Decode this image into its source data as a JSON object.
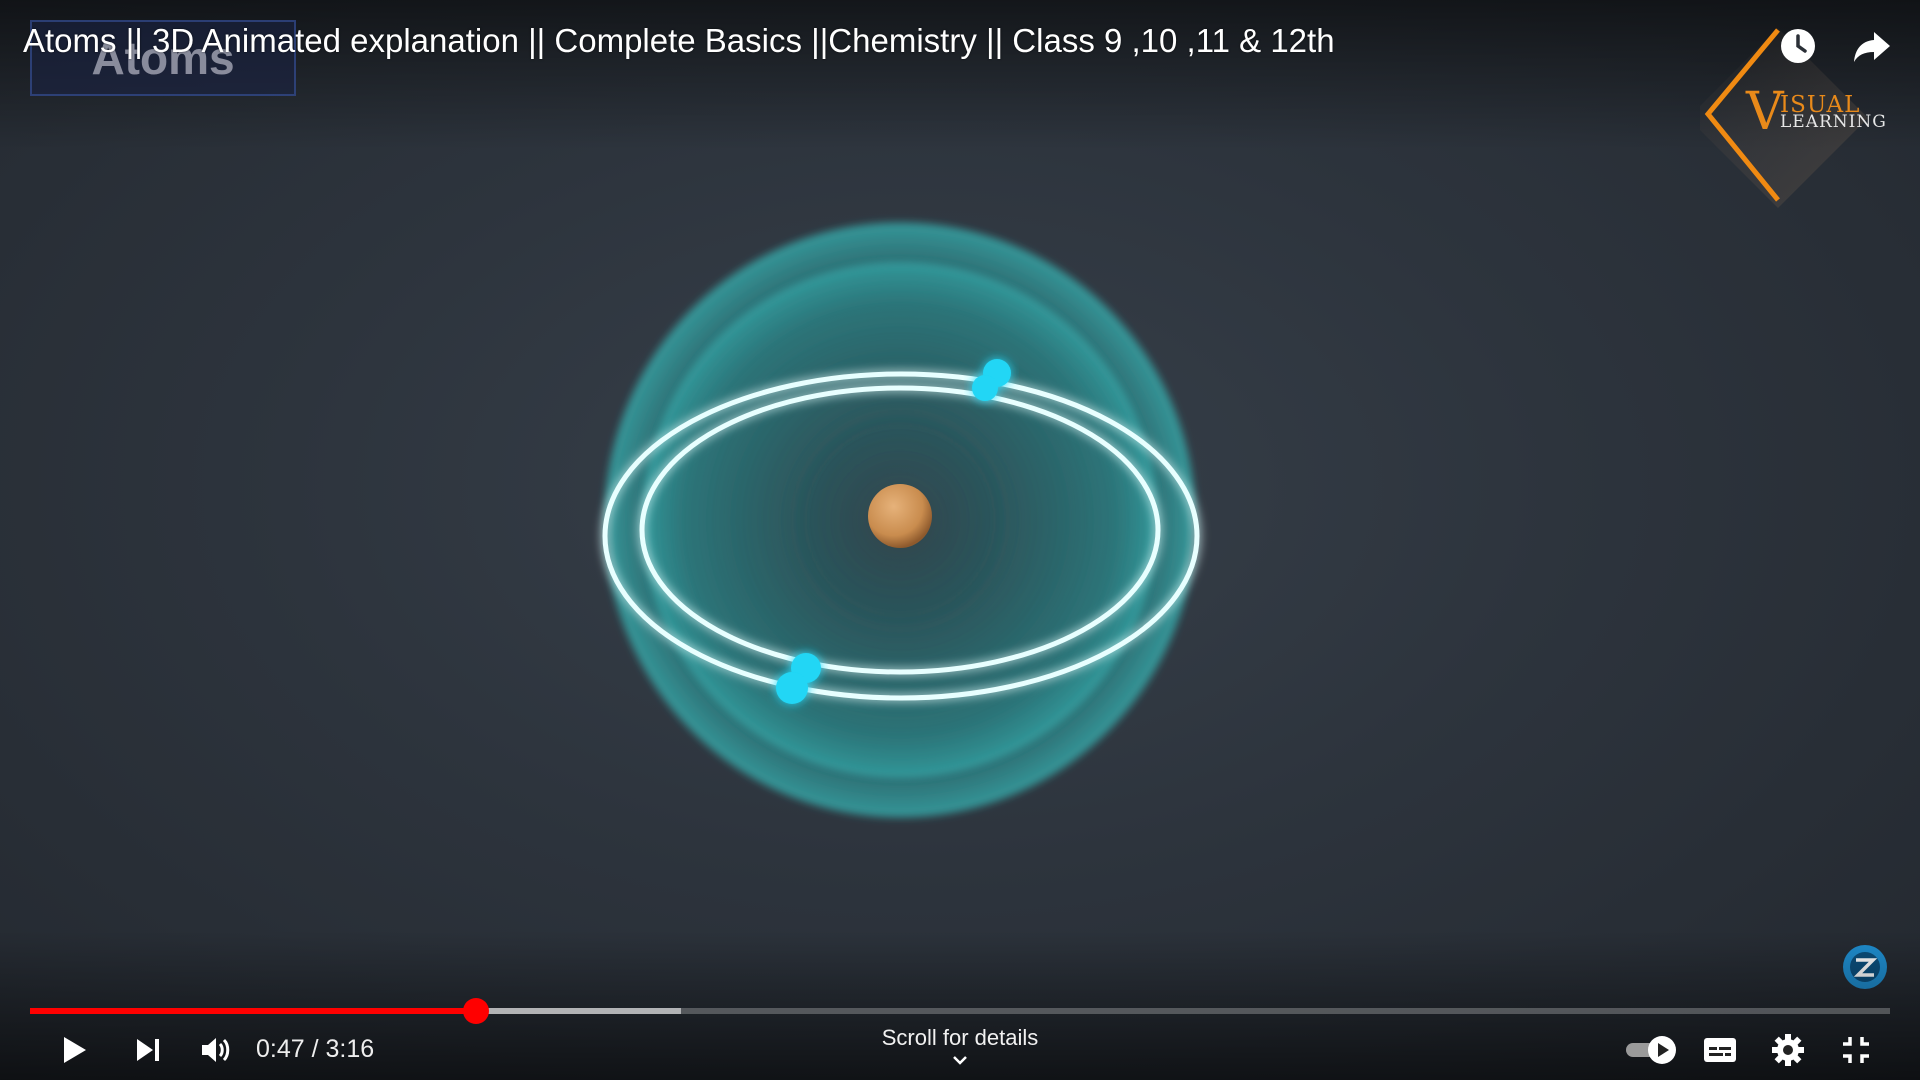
{
  "video": {
    "title": "Atoms || 3D Animated explanation || Complete Basics ||Chemistry || Class 9 ,10 ,11 & 12th",
    "slide_label": "Atoms"
  },
  "branding": {
    "logo_initial": "V",
    "logo_line1": "ISUAL",
    "logo_line2": "LEARNING",
    "accent_color": "#e98a1a"
  },
  "top_icons": [
    "watch-later-icon",
    "share-icon"
  ],
  "playback": {
    "current_time": "0:47",
    "separator": " / ",
    "duration": "3:16",
    "played_fraction": 0.24,
    "buffered_fraction": 0.35,
    "progress_color": "#ff0000"
  },
  "controls": {
    "left": [
      "play-icon",
      "next-icon",
      "volume-icon"
    ],
    "right": [
      "autoplay-toggle",
      "captions-icon",
      "settings-icon",
      "exit-fullscreen-icon"
    ],
    "scroll_hint": "Scroll for details"
  }
}
